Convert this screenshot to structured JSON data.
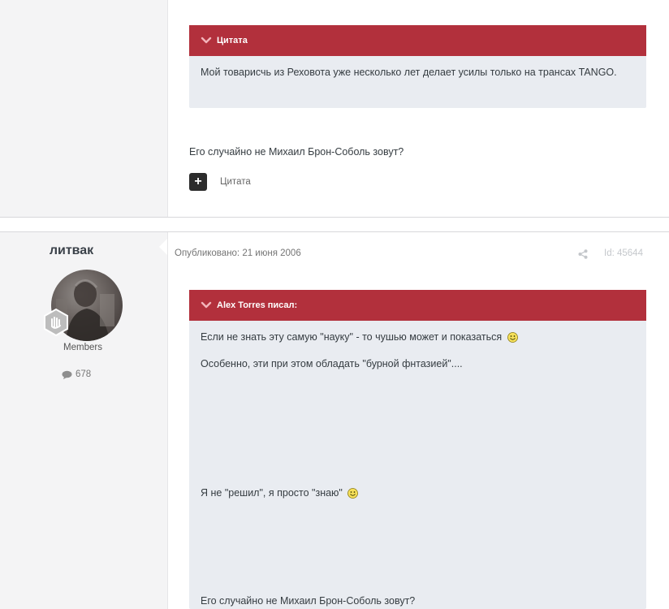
{
  "post_1": {
    "quote": {
      "header": "Цитата",
      "text": "Мой товарисчь из Реховота уже несколько лет делает усилы только на трансах TANGO."
    },
    "body_text": "Его случайно не Михаил Брон-Соболь зовут?",
    "multiquote_symbol": "+",
    "quote_button_label": "Цитата"
  },
  "post_2": {
    "author": {
      "username": "литвак",
      "group": "Members",
      "post_count": "678"
    },
    "posted_label": "Опубликовано: 21 июня 2006",
    "post_id": "Id: 45644",
    "quote": {
      "header": "Alex Torres писал:",
      "lines": [
        "Если не знать эту самую \"науку\" - то чушью может и показаться",
        "Особенно, эти при этом обладать \"бурной фнтазией\"....",
        "Я не \"решил\", я просто \"знаю\"",
        "Его случайно не Михаил Брон-Соболь зовут?"
      ]
    }
  },
  "colors": {
    "quote_header_bg": "#b2303c",
    "quote_body_bg": "#e9ecf1",
    "sidebar_bg": "#f4f4f5"
  },
  "icons": {
    "quote_chevron": "chevron-down-icon",
    "share": "share-icon",
    "post_count": "comment-icon",
    "rank": "rank-badge-icon",
    "smiley": "smiley-icon"
  }
}
